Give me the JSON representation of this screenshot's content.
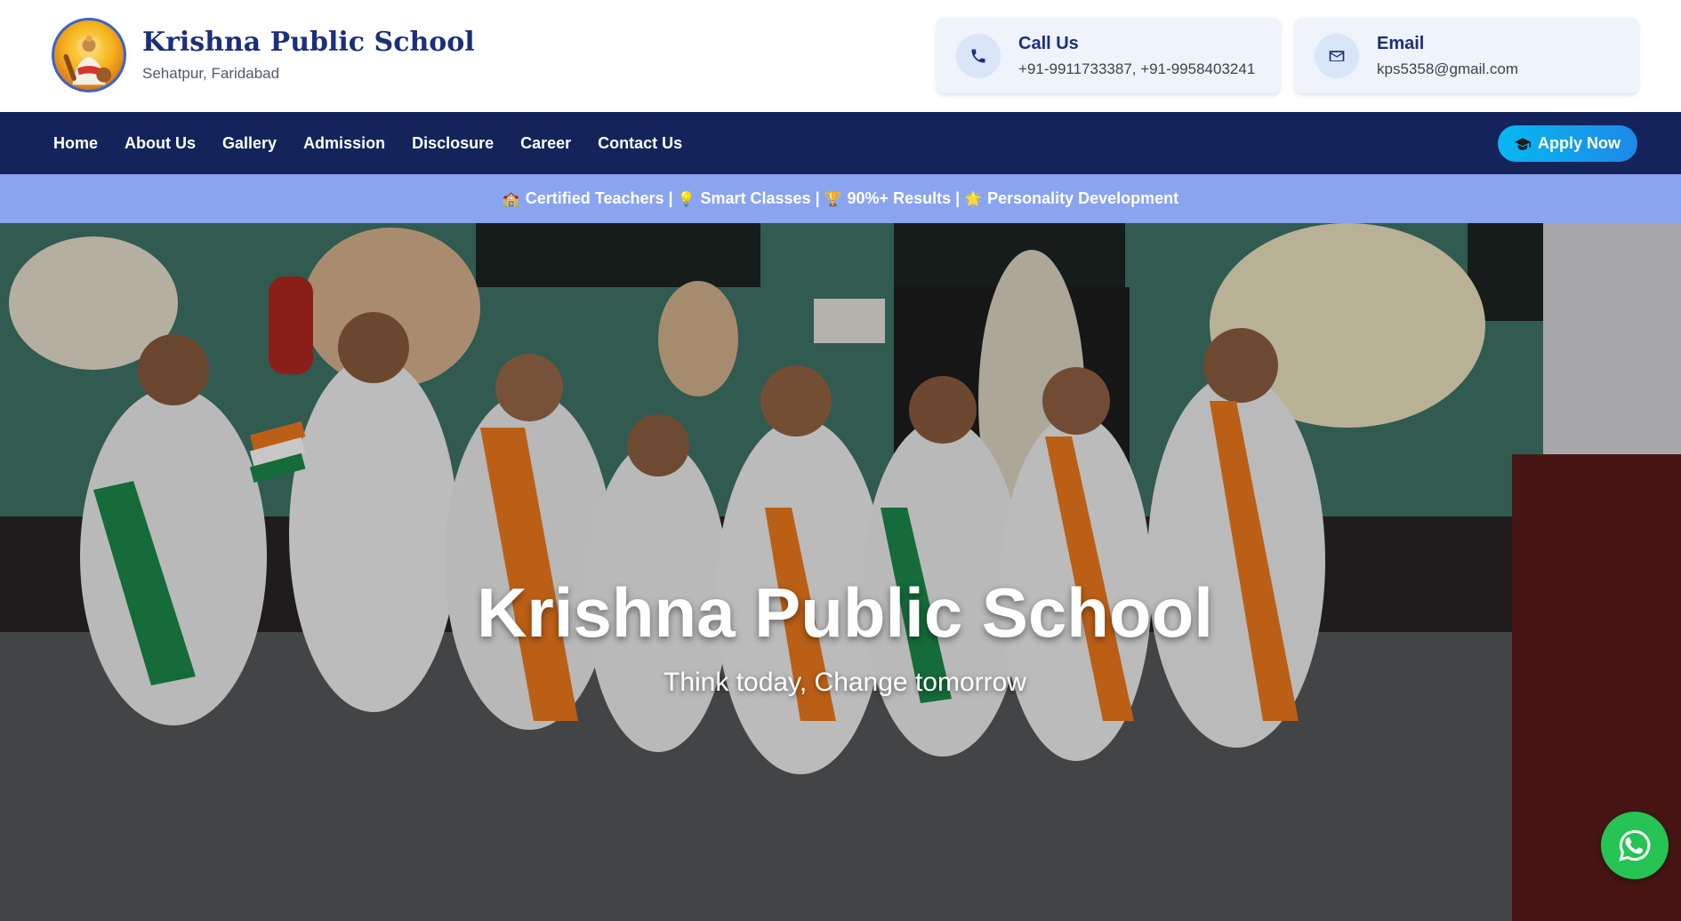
{
  "header": {
    "school_name": "Krishna Public School",
    "location": "Sehatpur, Faridabad",
    "logo_icon": "saraswati-logo-icon",
    "call": {
      "title": "Call Us",
      "value": "+91-9911733387, +91-9958403241",
      "icon": "phone-icon"
    },
    "email": {
      "title": "Email",
      "value": "kps5358@gmail.com",
      "icon": "envelope-icon"
    }
  },
  "nav": {
    "items": [
      {
        "label": "Home"
      },
      {
        "label": "About Us"
      },
      {
        "label": "Gallery"
      },
      {
        "label": "Admission"
      },
      {
        "label": "Disclosure"
      },
      {
        "label": "Career"
      },
      {
        "label": "Contact Us"
      }
    ],
    "apply_label": "Apply Now",
    "apply_icon": "graduation-cap-icon"
  },
  "highlights": {
    "items": [
      {
        "emoji": "🏫",
        "label": "Certified Teachers"
      },
      {
        "emoji": "💡",
        "label": "Smart Classes"
      },
      {
        "emoji": "🏆",
        "label": "90%+ Results"
      },
      {
        "emoji": "🌟",
        "label": "Personality Development"
      }
    ],
    "separator": "|"
  },
  "hero": {
    "title": "Krishna Public School",
    "tagline": "Think today, Change tomorrow",
    "background_description_icon": "students-photo"
  },
  "floating": {
    "whatsapp_icon": "whatsapp-icon"
  },
  "colors": {
    "brand_navy": "#14245b",
    "title_blue": "#1c2f7a",
    "strip_blue": "#8aa4ef",
    "apply_cyan": "#06b8f0",
    "whatsapp_green": "#25c454"
  }
}
